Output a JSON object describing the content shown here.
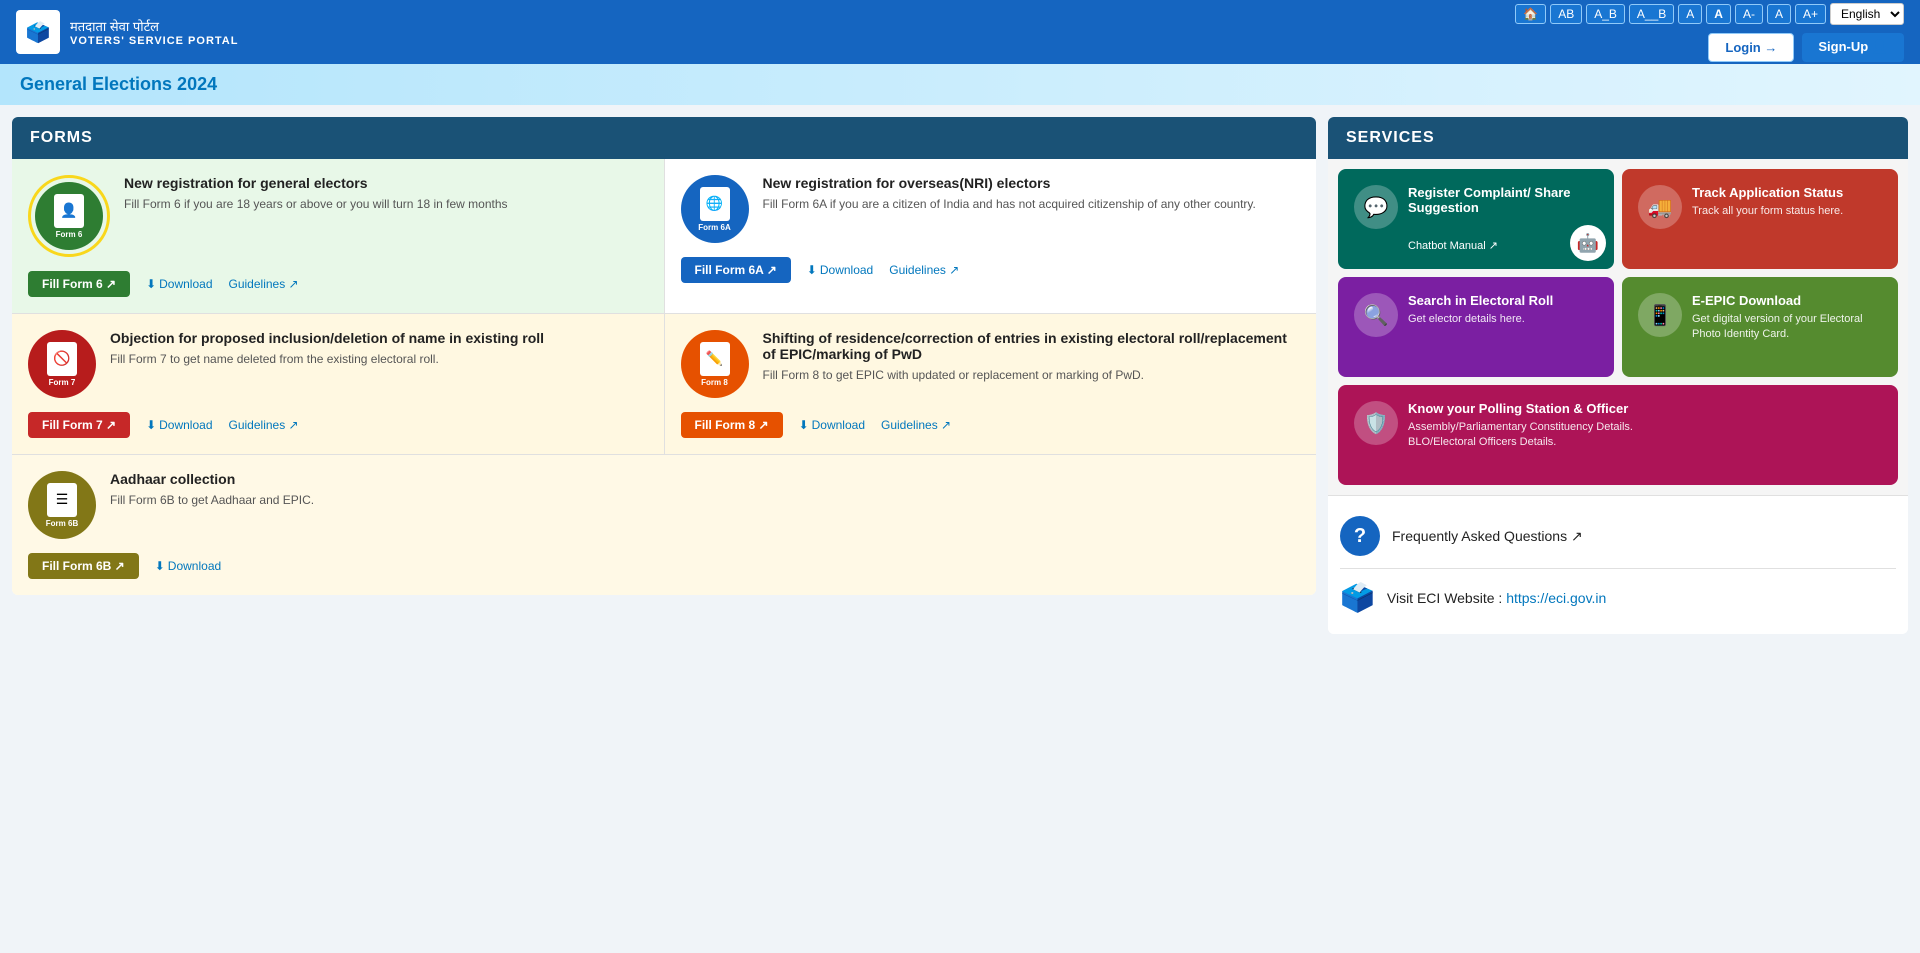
{
  "header": {
    "logo_text": "🗳️",
    "title_hindi": "मतदाता सेवा पोर्टल",
    "title_eng": "VOTERS' SERVICE PORTAL",
    "accessibility": {
      "home": "🏠",
      "contrast1": "AB",
      "contrast2": "A_B",
      "contrast3": "A__B",
      "font_A": "A",
      "font_A_bold": "A",
      "font_minus": "A-",
      "font_normal": "A",
      "font_plus": "A+"
    },
    "language": "English",
    "login_label": "Login →",
    "signup_label": "Sign-Up 👤"
  },
  "banner": {
    "text": "General Elections 2024"
  },
  "forms_section": {
    "header": "FORMS",
    "cards": [
      {
        "id": "form6",
        "icon_label": "Form 6",
        "icon_bg": "green",
        "title": "New registration for general electors",
        "desc": "Fill Form 6 if you are 18 years or above or you will turn 18 in few months",
        "fill_label": "Fill Form 6 ↗",
        "fill_color": "green",
        "download_label": "Download",
        "guidelines_label": "Guidelines ↗",
        "highlighted": true
      },
      {
        "id": "form6a",
        "icon_label": "Form 6A",
        "icon_bg": "blue",
        "title": "New registration for overseas(NRI) electors",
        "desc": "Fill Form 6A if you are a citizen of India and has not acquired citizenship of any other country.",
        "fill_label": "Fill Form 6A ↗",
        "fill_color": "blue",
        "download_label": "Download",
        "guidelines_label": "Guidelines ↗",
        "highlighted": false
      },
      {
        "id": "form7",
        "icon_label": "Form 7",
        "icon_bg": "red-dark",
        "title": "Objection for proposed inclusion/deletion of name in existing roll",
        "desc": "Fill Form 7 to get name deleted from the existing electoral roll.",
        "fill_label": "Fill Form 7 ↗",
        "fill_color": "red",
        "download_label": "Download",
        "guidelines_label": "Guidelines ↗"
      },
      {
        "id": "form8",
        "icon_label": "Form 8",
        "icon_bg": "orange",
        "title": "Shifting of residence/correction of entries in existing electoral roll/replacement of EPIC/marking of PwD",
        "desc": "Fill Form 8 to get EPIC with updated or replacement or marking of PwD.",
        "fill_label": "Fill Form 8 ↗",
        "fill_color": "orange",
        "download_label": "Download",
        "guidelines_label": "Guidelines ↗"
      }
    ],
    "form6b": {
      "id": "form6b",
      "icon_label": "Form 6B",
      "icon_bg": "olive",
      "title": "Aadhaar collection",
      "desc": "Fill Form 6B to get Aadhaar and EPIC.",
      "fill_label": "Fill Form 6B ↗",
      "fill_color": "olive",
      "download_label": "Download"
    }
  },
  "services_section": {
    "header": "SERVICES",
    "cards": [
      {
        "id": "register-complaint",
        "color": "teal",
        "icon": "💬",
        "title": "Register Complaint/ Share Suggestion",
        "desc": "",
        "chatbot": true,
        "chatbot_label": "Chatbot Manual ↗"
      },
      {
        "id": "track-application",
        "color": "coral",
        "icon": "🚚",
        "title": "Track Application Status",
        "desc": "Track all your form status here."
      },
      {
        "id": "search-electoral",
        "color": "purple",
        "icon": "🔍",
        "title": "Search in Electoral Roll",
        "desc": "Get elector details here."
      },
      {
        "id": "epic-download",
        "color": "olive-dark",
        "icon": "📱",
        "title": "E-EPIC Download",
        "desc": "Get digital version of your Electoral Photo Identity Card."
      },
      {
        "id": "polling-station",
        "color": "pink",
        "icon": "🛡️",
        "title": "Know your Polling Station & Officer",
        "desc_line1": "Assembly/Parliamentary Constituency Details.",
        "desc_line2": "BLO/Electoral Officers Details."
      }
    ]
  },
  "faq": {
    "label": "Frequently Asked Questions ↗"
  },
  "visit_eci": {
    "label_prefix": "Visit ECI Website : ",
    "link_text": "https://eci.gov.in",
    "link_url": "https://eci.gov.in"
  }
}
